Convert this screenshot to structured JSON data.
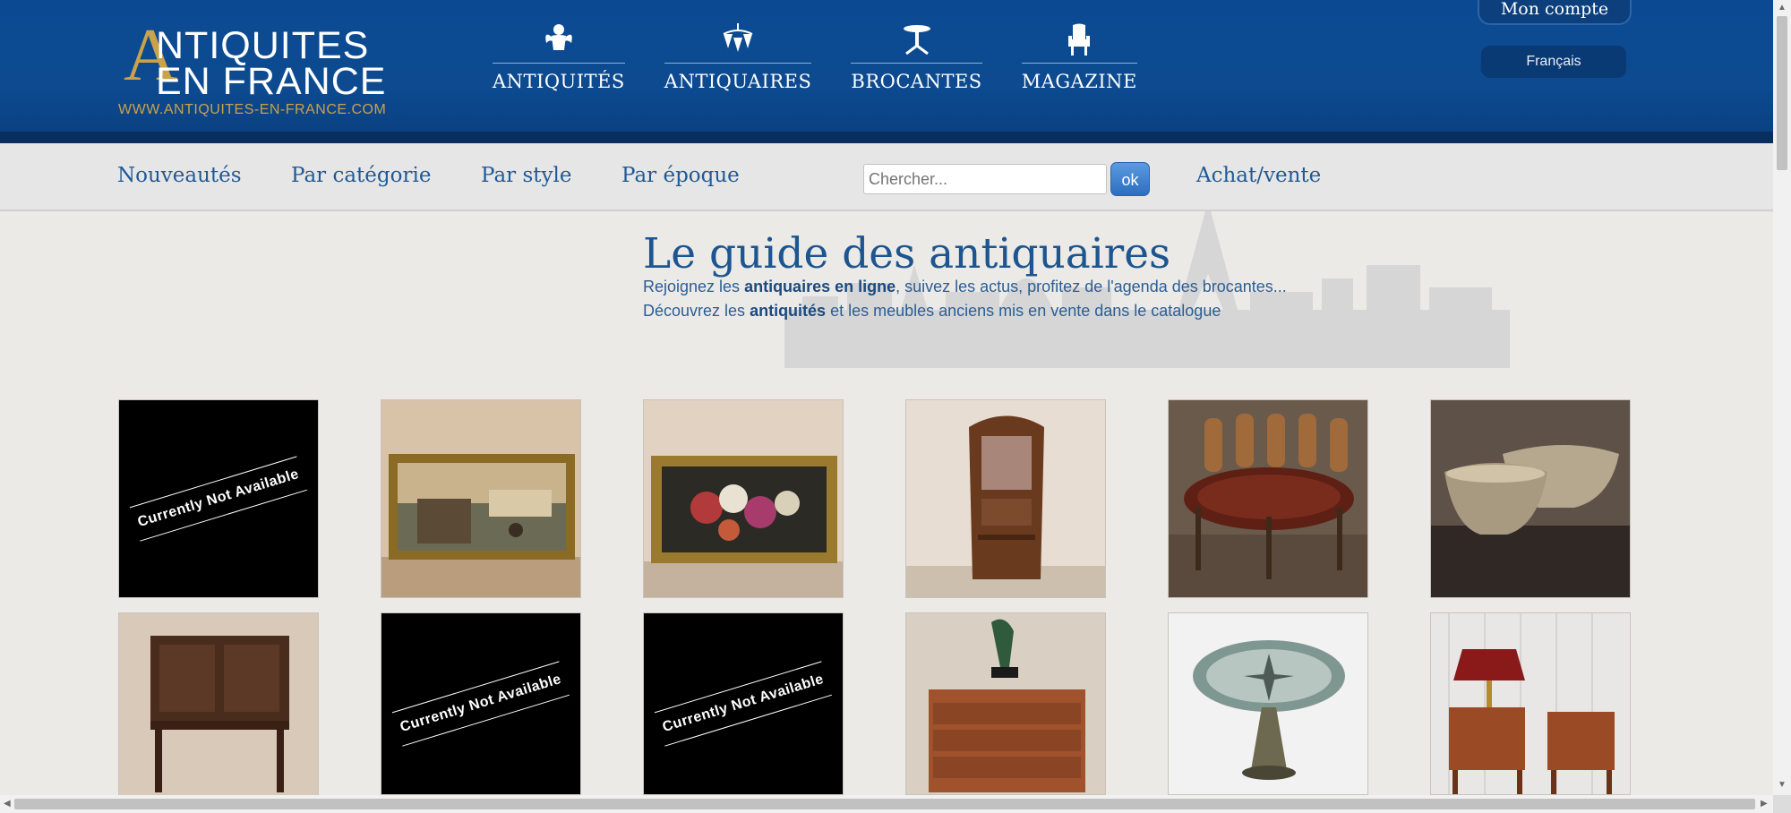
{
  "logo": {
    "a_letter": "A",
    "line1": "NTIQUITES",
    "line2": "EN FRANCE",
    "url": "WWW.ANTIQUITES-EN-FRANCE.COM"
  },
  "main_nav": [
    {
      "label": "ANTIQUITÉS",
      "icon": "cherub-icon"
    },
    {
      "label": "ANTIQUAIRES",
      "icon": "chandelier-icon"
    },
    {
      "label": "BROCANTES",
      "icon": "pedestal-table-icon"
    },
    {
      "label": "MAGAZINE",
      "icon": "armchair-icon"
    }
  ],
  "account": {
    "label": "Mon compte",
    "language": "Français"
  },
  "subnav": {
    "items": [
      "Nouveautés",
      "Par catégorie",
      "Par style",
      "Par époque"
    ],
    "search_placeholder": "Chercher...",
    "search_button": "ok",
    "buy_sell": "Achat/vente"
  },
  "hero": {
    "title": "Le guide des antiquaires",
    "line1_pre": "Rejoignez les ",
    "line1_bold": "antiquaires en ligne",
    "line1_post": ", suivez les actus, profitez de l'agenda des brocantes...",
    "line2_pre": "Découvrez les ",
    "line2_bold": "antiquités",
    "line2_post": " et les meubles anciens mis en vente dans le catalogue"
  },
  "tiles": [
    {
      "kind": "not-available",
      "text": "Currently Not Available"
    },
    {
      "kind": "image",
      "subject": "framed-landscape-painting"
    },
    {
      "kind": "image",
      "subject": "framed-flower-painting"
    },
    {
      "kind": "image",
      "subject": "art-nouveau-vitrine"
    },
    {
      "kind": "image",
      "subject": "round-dining-table-with-chairs"
    },
    {
      "kind": "image",
      "subject": "stone-bowls"
    },
    {
      "kind": "image",
      "subject": "carved-cabinet"
    },
    {
      "kind": "not-available",
      "text": "Currently Not Available"
    },
    {
      "kind": "not-available",
      "text": "Currently Not Available"
    },
    {
      "kind": "image",
      "subject": "chest-with-bronze-statue"
    },
    {
      "kind": "image",
      "subject": "round-pedestal-table"
    },
    {
      "kind": "image",
      "subject": "bedside-tables-with-lamp"
    }
  ],
  "colors": {
    "header_blue": "#0b4a92",
    "gold": "#c9a24a",
    "link_blue": "#1f5a97"
  }
}
